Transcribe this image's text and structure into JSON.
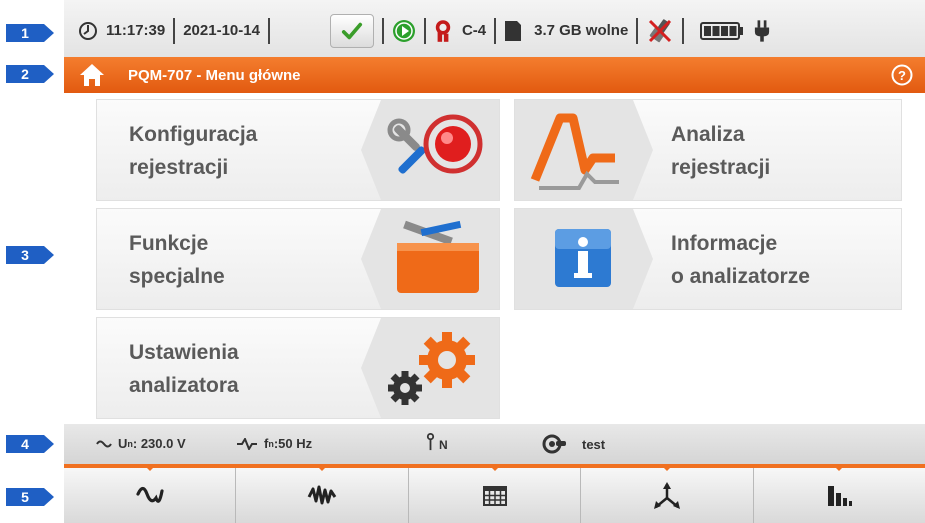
{
  "markers": [
    "1",
    "2",
    "3",
    "4",
    "5"
  ],
  "status": {
    "time": "11:17:39",
    "date": "2021-10-14",
    "clamp": "C-4",
    "storage": "3.7 GB wolne"
  },
  "titlebar": {
    "title": "PQM-707 - Menu główne"
  },
  "tiles": {
    "config": {
      "line1": "Konfiguracja",
      "line2": "rejestracji"
    },
    "analysis": {
      "line1": "Analiza",
      "line2": "rejestracji"
    },
    "special": {
      "line1": "Funkcje",
      "line2": "specjalne"
    },
    "info": {
      "line1": "Informacje",
      "line2": "o analizatorze"
    },
    "settings": {
      "line1": "Ustawienia",
      "line2": "analizatora"
    }
  },
  "infobar": {
    "un_label": "U",
    "un_sub": "n",
    "un_value": ": 230.0 V",
    "fn_label": "f",
    "fn_sub": "n",
    "fn_value": ":50 Hz",
    "neutral": "N",
    "profile": "test"
  },
  "colors": {
    "accent": "#f07020",
    "marker": "#1f5fc4",
    "title_bg": "#e8661a"
  }
}
